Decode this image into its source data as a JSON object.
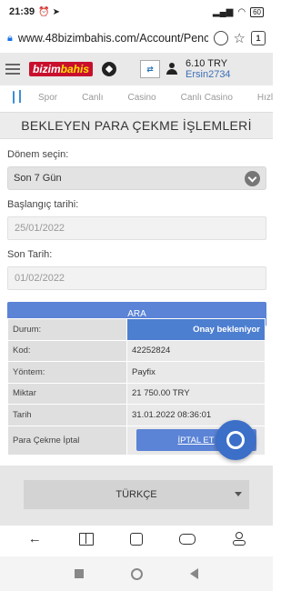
{
  "status_bar": {
    "time": "21:39",
    "battery": "60"
  },
  "browser": {
    "url": "www.48bizimbahis.com/Account/Penc",
    "tab_count": "1"
  },
  "header": {
    "logo_part1": "bizim",
    "logo_part2": "bahis",
    "balance": "6.10 TRY",
    "username": "Ersin2734"
  },
  "nav": {
    "items": [
      "Spor",
      "Canlı",
      "Casino",
      "Canlı Casino",
      "Hızlı K"
    ]
  },
  "page": {
    "title": "BEKLEYEN PARA ÇEKME İŞLEMLERİ"
  },
  "form": {
    "period_label": "Dönem seçin:",
    "period_value": "Son 7 Gün",
    "start_label": "Başlangıç tarihi:",
    "start_placeholder": "25/01/2022",
    "end_label": "Son Tarih:",
    "end_placeholder": "01/02/2022",
    "search_label": "ARA"
  },
  "details": {
    "status_key": "Durum:",
    "status_value": "Onay bekleniyor",
    "code_key": "Kod:",
    "code_value": "42252824",
    "method_key": "Yöntem:",
    "method_value": "Payfix",
    "amount_key": "Miktar",
    "amount_value": "21 750.00 TRY",
    "date_key": "Tarih",
    "date_value": "31.01.2022 08:36:01",
    "cancel_key": "Para Çekme İptal",
    "cancel_button": "İPTAL ET"
  },
  "language": {
    "selected": "TÜRKÇE"
  }
}
